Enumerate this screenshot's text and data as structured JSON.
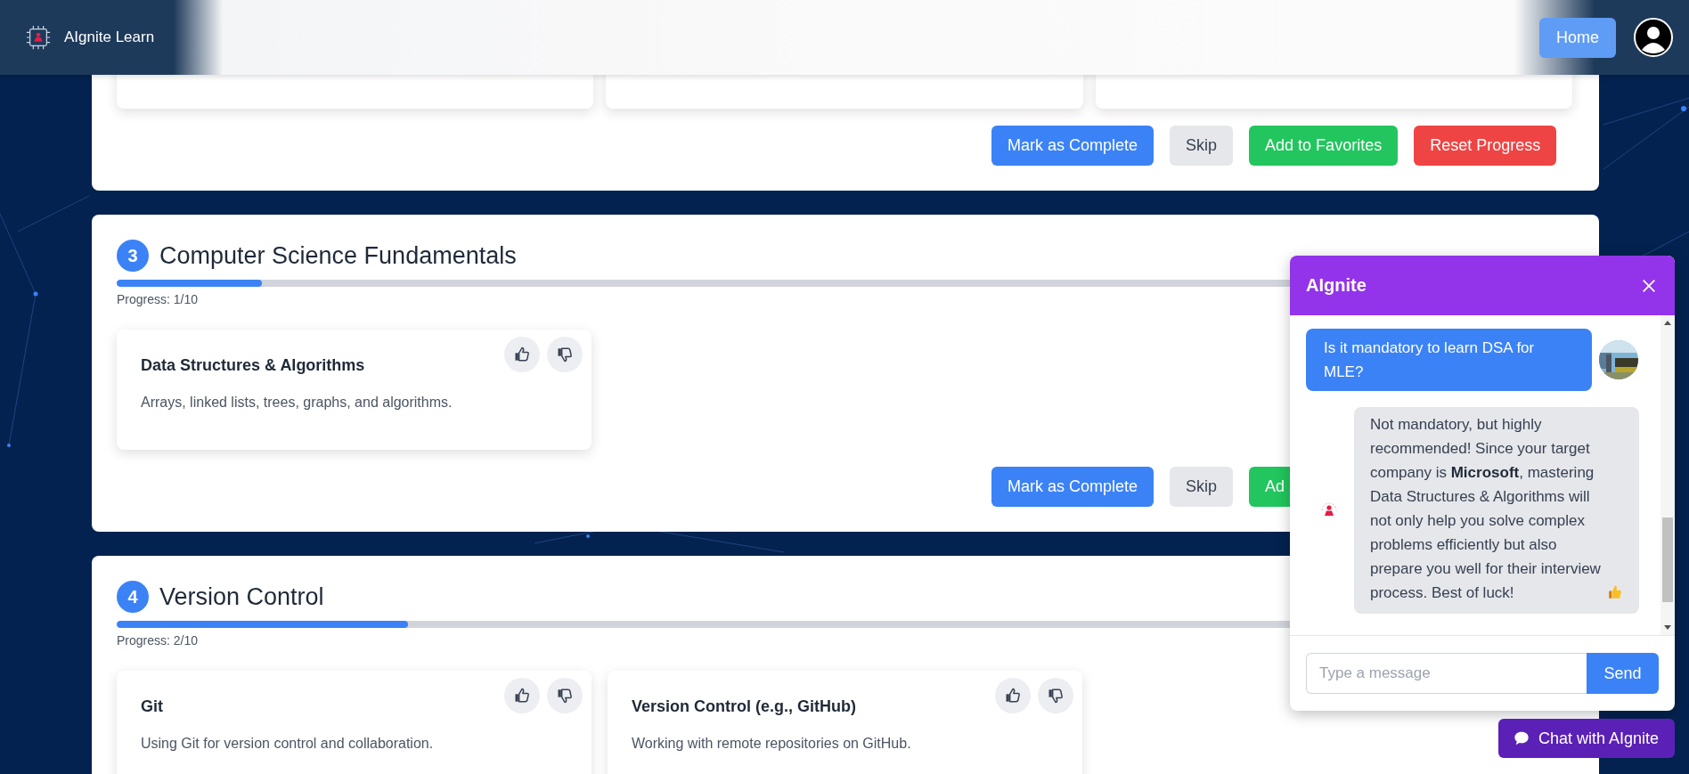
{
  "header": {
    "brand": "AIgnite Learn",
    "home_button": "Home"
  },
  "sections": [
    {
      "kind": "partial",
      "cards": [
        {
          "kind": "hidden"
        },
        {
          "kind": "hidden"
        },
        {
          "kind": "hidden"
        }
      ],
      "actions": [
        {
          "label": "Mark as Complete",
          "kind": "primary"
        },
        {
          "label": "Skip",
          "kind": "neutral"
        },
        {
          "label": "Add to Favorites",
          "kind": "favorite"
        },
        {
          "label": "Reset Progress",
          "kind": "danger"
        }
      ]
    },
    {
      "kind": "full",
      "number": "3",
      "title": "Computer Science Fundamentals",
      "level": 0.1,
      "progress": "Progress: 1/10",
      "cards": [
        {
          "kind": "topic",
          "title": "Data Structures & Algorithms",
          "description": "Arrays, linked lists, trees, graphs, and algorithms."
        }
      ],
      "actions": [
        {
          "label": "Mark as Complete",
          "kind": "primary"
        },
        {
          "label": "Skip",
          "kind": "neutral"
        },
        {
          "label": "Ad",
          "kind": "favorite"
        }
      ]
    },
    {
      "kind": "full",
      "number": "4",
      "title": "Version Control",
      "level": 0.2,
      "progress": "Progress: 2/10",
      "cards": [
        {
          "kind": "topic",
          "title": "Git",
          "description": "Using Git for version control and collaboration."
        },
        {
          "kind": "topic",
          "title": "Version Control (e.g., GitHub)",
          "description": "Working with remote repositories on GitHub."
        }
      ]
    }
  ],
  "chat": {
    "title": "AIgnite",
    "messages": [
      {
        "kind": "user",
        "text": "Is it mandatory to learn DSA for MLE?"
      },
      {
        "kind": "bot",
        "text": "Not mandatory, but highly recommended! Since your target company is **Microsoft**, mastering Data Structures & Algorithms will not only help you solve complex problems efficiently but also prepare you well for their interview process. Best of luck!",
        "thumbs_up": true
      }
    ],
    "input": {
      "placeholder": "Type a message"
    },
    "send_button": "Send"
  },
  "chat_button": "Chat with AIgnite"
}
